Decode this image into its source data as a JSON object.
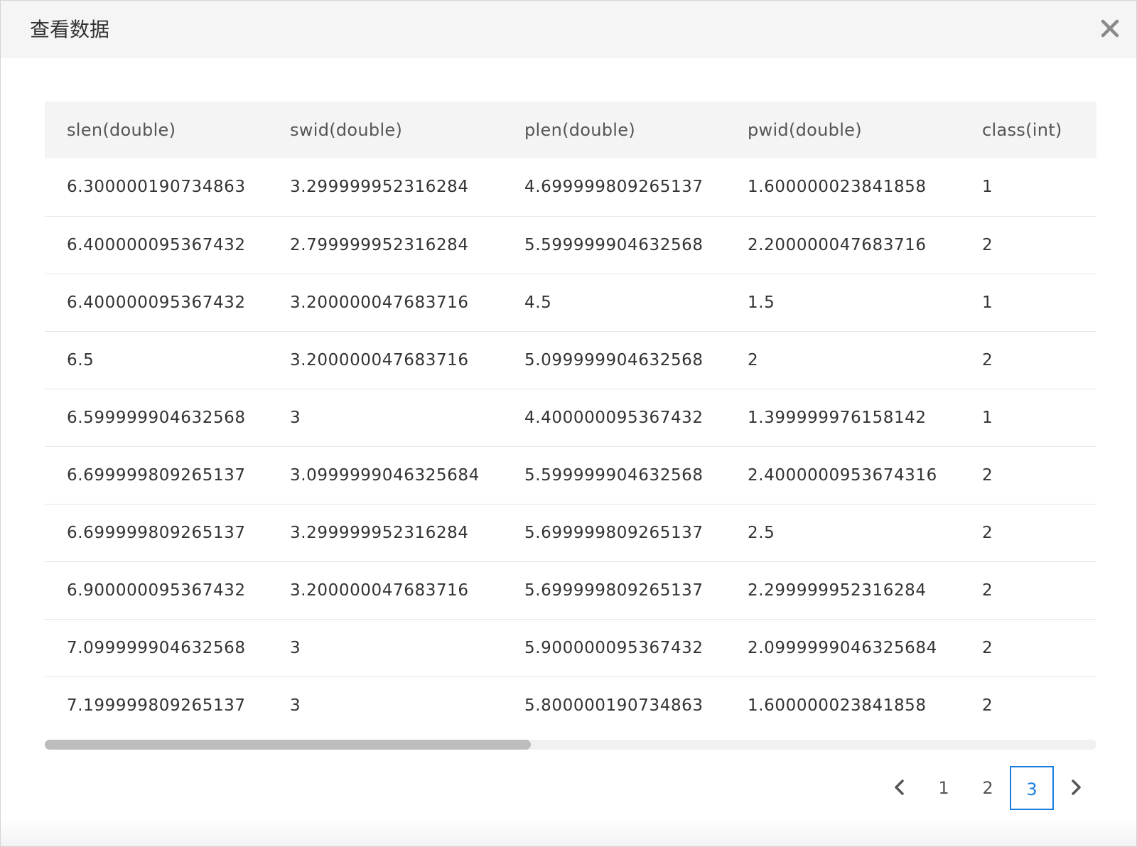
{
  "dialog": {
    "title": "查看数据"
  },
  "table": {
    "columns": [
      "slen(double)",
      "swid(double)",
      "plen(double)",
      "pwid(double)",
      "class(int)"
    ],
    "rows": [
      [
        "6.300000190734863",
        "3.299999952316284",
        "4.699999809265137",
        "1.600000023841858",
        "1"
      ],
      [
        "6.400000095367432",
        "2.799999952316284",
        "5.599999904632568",
        "2.200000047683716",
        "2"
      ],
      [
        "6.400000095367432",
        "3.200000047683716",
        "4.5",
        "1.5",
        "1"
      ],
      [
        "6.5",
        "3.200000047683716",
        "5.099999904632568",
        "2",
        "2"
      ],
      [
        "6.599999904632568",
        "3",
        "4.400000095367432",
        "1.399999976158142",
        "1"
      ],
      [
        "6.699999809265137",
        "3.0999999046325684",
        "5.599999904632568",
        "2.4000000953674316",
        "2"
      ],
      [
        "6.699999809265137",
        "3.299999952316284",
        "5.699999809265137",
        "2.5",
        "2"
      ],
      [
        "6.900000095367432",
        "3.200000047683716",
        "5.699999809265137",
        "2.299999952316284",
        "2"
      ],
      [
        "7.099999904632568",
        "3",
        "5.900000095367432",
        "2.0999999046325684",
        "2"
      ],
      [
        "7.199999809265137",
        "3",
        "5.800000190734863",
        "1.600000023841858",
        "2"
      ]
    ]
  },
  "pagination": {
    "prev_icon": "chevron-left-icon",
    "next_icon": "chevron-right-icon",
    "pages": [
      "1",
      "2",
      "3"
    ],
    "current_page": "3"
  },
  "colors": {
    "accent": "#1a7fe0",
    "header_bg": "#f5f5f5"
  },
  "icons": {
    "close": "close-icon"
  }
}
